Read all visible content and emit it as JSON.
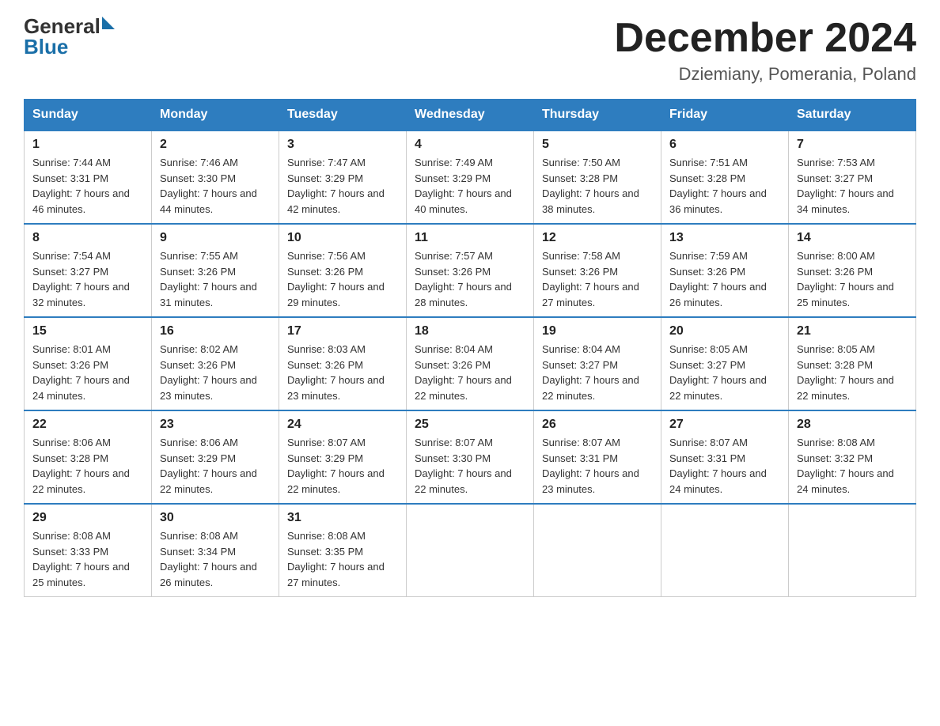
{
  "header": {
    "month_title": "December 2024",
    "location": "Dziemiany, Pomerania, Poland",
    "logo_general": "General",
    "logo_blue": "Blue"
  },
  "days_of_week": [
    "Sunday",
    "Monday",
    "Tuesday",
    "Wednesday",
    "Thursday",
    "Friday",
    "Saturday"
  ],
  "weeks": [
    [
      {
        "day": "1",
        "sunrise": "7:44 AM",
        "sunset": "3:31 PM",
        "daylight": "7 hours and 46 minutes."
      },
      {
        "day": "2",
        "sunrise": "7:46 AM",
        "sunset": "3:30 PM",
        "daylight": "7 hours and 44 minutes."
      },
      {
        "day": "3",
        "sunrise": "7:47 AM",
        "sunset": "3:29 PM",
        "daylight": "7 hours and 42 minutes."
      },
      {
        "day": "4",
        "sunrise": "7:49 AM",
        "sunset": "3:29 PM",
        "daylight": "7 hours and 40 minutes."
      },
      {
        "day": "5",
        "sunrise": "7:50 AM",
        "sunset": "3:28 PM",
        "daylight": "7 hours and 38 minutes."
      },
      {
        "day": "6",
        "sunrise": "7:51 AM",
        "sunset": "3:28 PM",
        "daylight": "7 hours and 36 minutes."
      },
      {
        "day": "7",
        "sunrise": "7:53 AM",
        "sunset": "3:27 PM",
        "daylight": "7 hours and 34 minutes."
      }
    ],
    [
      {
        "day": "8",
        "sunrise": "7:54 AM",
        "sunset": "3:27 PM",
        "daylight": "7 hours and 32 minutes."
      },
      {
        "day": "9",
        "sunrise": "7:55 AM",
        "sunset": "3:26 PM",
        "daylight": "7 hours and 31 minutes."
      },
      {
        "day": "10",
        "sunrise": "7:56 AM",
        "sunset": "3:26 PM",
        "daylight": "7 hours and 29 minutes."
      },
      {
        "day": "11",
        "sunrise": "7:57 AM",
        "sunset": "3:26 PM",
        "daylight": "7 hours and 28 minutes."
      },
      {
        "day": "12",
        "sunrise": "7:58 AM",
        "sunset": "3:26 PM",
        "daylight": "7 hours and 27 minutes."
      },
      {
        "day": "13",
        "sunrise": "7:59 AM",
        "sunset": "3:26 PM",
        "daylight": "7 hours and 26 minutes."
      },
      {
        "day": "14",
        "sunrise": "8:00 AM",
        "sunset": "3:26 PM",
        "daylight": "7 hours and 25 minutes."
      }
    ],
    [
      {
        "day": "15",
        "sunrise": "8:01 AM",
        "sunset": "3:26 PM",
        "daylight": "7 hours and 24 minutes."
      },
      {
        "day": "16",
        "sunrise": "8:02 AM",
        "sunset": "3:26 PM",
        "daylight": "7 hours and 23 minutes."
      },
      {
        "day": "17",
        "sunrise": "8:03 AM",
        "sunset": "3:26 PM",
        "daylight": "7 hours and 23 minutes."
      },
      {
        "day": "18",
        "sunrise": "8:04 AM",
        "sunset": "3:26 PM",
        "daylight": "7 hours and 22 minutes."
      },
      {
        "day": "19",
        "sunrise": "8:04 AM",
        "sunset": "3:27 PM",
        "daylight": "7 hours and 22 minutes."
      },
      {
        "day": "20",
        "sunrise": "8:05 AM",
        "sunset": "3:27 PM",
        "daylight": "7 hours and 22 minutes."
      },
      {
        "day": "21",
        "sunrise": "8:05 AM",
        "sunset": "3:28 PM",
        "daylight": "7 hours and 22 minutes."
      }
    ],
    [
      {
        "day": "22",
        "sunrise": "8:06 AM",
        "sunset": "3:28 PM",
        "daylight": "7 hours and 22 minutes."
      },
      {
        "day": "23",
        "sunrise": "8:06 AM",
        "sunset": "3:29 PM",
        "daylight": "7 hours and 22 minutes."
      },
      {
        "day": "24",
        "sunrise": "8:07 AM",
        "sunset": "3:29 PM",
        "daylight": "7 hours and 22 minutes."
      },
      {
        "day": "25",
        "sunrise": "8:07 AM",
        "sunset": "3:30 PM",
        "daylight": "7 hours and 22 minutes."
      },
      {
        "day": "26",
        "sunrise": "8:07 AM",
        "sunset": "3:31 PM",
        "daylight": "7 hours and 23 minutes."
      },
      {
        "day": "27",
        "sunrise": "8:07 AM",
        "sunset": "3:31 PM",
        "daylight": "7 hours and 24 minutes."
      },
      {
        "day": "28",
        "sunrise": "8:08 AM",
        "sunset": "3:32 PM",
        "daylight": "7 hours and 24 minutes."
      }
    ],
    [
      {
        "day": "29",
        "sunrise": "8:08 AM",
        "sunset": "3:33 PM",
        "daylight": "7 hours and 25 minutes."
      },
      {
        "day": "30",
        "sunrise": "8:08 AM",
        "sunset": "3:34 PM",
        "daylight": "7 hours and 26 minutes."
      },
      {
        "day": "31",
        "sunrise": "8:08 AM",
        "sunset": "3:35 PM",
        "daylight": "7 hours and 27 minutes."
      },
      null,
      null,
      null,
      null
    ]
  ]
}
